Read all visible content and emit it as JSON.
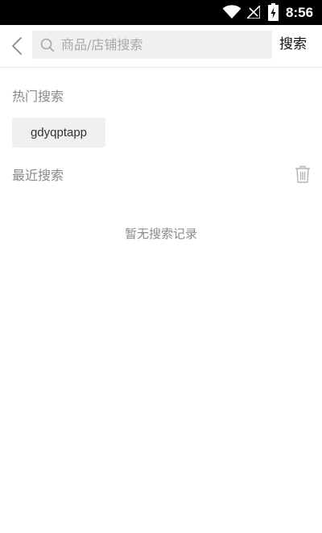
{
  "status_bar": {
    "time": "8:56",
    "icons": [
      "wifi-icon",
      "signal-icon",
      "battery-icon"
    ]
  },
  "header": {
    "search_placeholder": "商品/店铺搜索",
    "search_value": "",
    "submit_label": "搜索",
    "icons": [
      "back-arrow-icon",
      "search-icon"
    ]
  },
  "hot_search": {
    "title": "热门搜索",
    "tags": [
      "gdyqptapp"
    ]
  },
  "recent_search": {
    "title": "最近搜索",
    "empty_text": "暂无搜索记录",
    "icons": [
      "trash-icon"
    ]
  },
  "colors": {
    "text_primary": "#333333",
    "text_secondary": "#8a8a8a",
    "placeholder": "#a8a8a8",
    "input_bg": "#f0f0f0",
    "status_bar_bg": "#000000"
  }
}
